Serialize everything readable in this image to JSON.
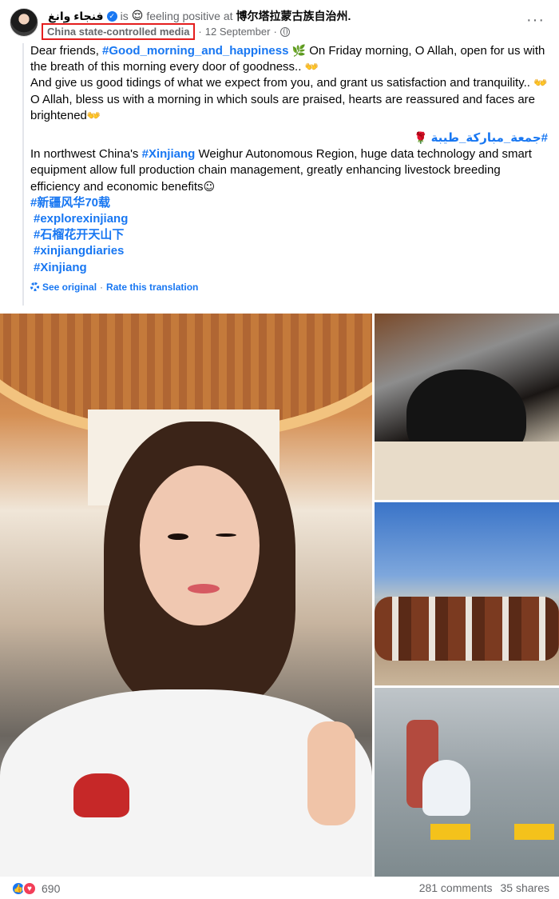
{
  "post": {
    "author": "فنجاء وانغ",
    "is_text": "is",
    "feeling_emoji": "😌",
    "feeling_text": "feeling positive at",
    "location": "博尔塔拉蒙古族自治州.",
    "media_label": "China state-controlled media",
    "separator": "·",
    "date": "12 September",
    "more": "···",
    "text": {
      "p1_a": "Dear friends, ",
      "p1_hashtag": "#Good_morning_and_happiness",
      "p1_emoji": "🌿",
      "p1_b": " On Friday morning, O Allah, open for us with the breath of this morning every door of goodness.. ",
      "p1_emoji2": "👐",
      "p2": "And give us good tidings of what we expect from you, and grant us satisfaction and tranquility.. ",
      "p2_emoji": "👐",
      "p3": "O Allah, bless us with a morning in which souls are praised, hearts are reassured and faces are brightened",
      "p3_emoji": "👐",
      "arabic_hashtag": "#جمعة_مباركة_طيبة",
      "arabic_emoji": "🌹",
      "p4_a": "In northwest China's ",
      "p4_hashtag": "#Xinjiang",
      "p4_b": " Weighur Autonomous Region, huge data technology and smart equipment allow full production chain management, greatly enhancing livestock breeding efficiency and economic benefits",
      "p4_emoji": "☺",
      "tags": [
        "#新疆风华70载",
        "#explorexinjiang",
        "#石榴花开天山下",
        "#xinjiangdiaries",
        "#Xinjiang"
      ]
    },
    "translation": {
      "see_original": "See original",
      "dot": "·",
      "rate": "Rate this translation"
    },
    "footer": {
      "reaction_count": "690",
      "comments": "281 comments",
      "shares": "35 shares"
    }
  },
  "icons": {
    "verified": "verified-badge-icon",
    "globe": "globe-icon",
    "gear": "gear-icon",
    "like": "like-icon",
    "love": "love-icon"
  },
  "colors": {
    "link": "#1877f2",
    "muted": "#65676b",
    "highlight_box": "#e41e1e"
  }
}
